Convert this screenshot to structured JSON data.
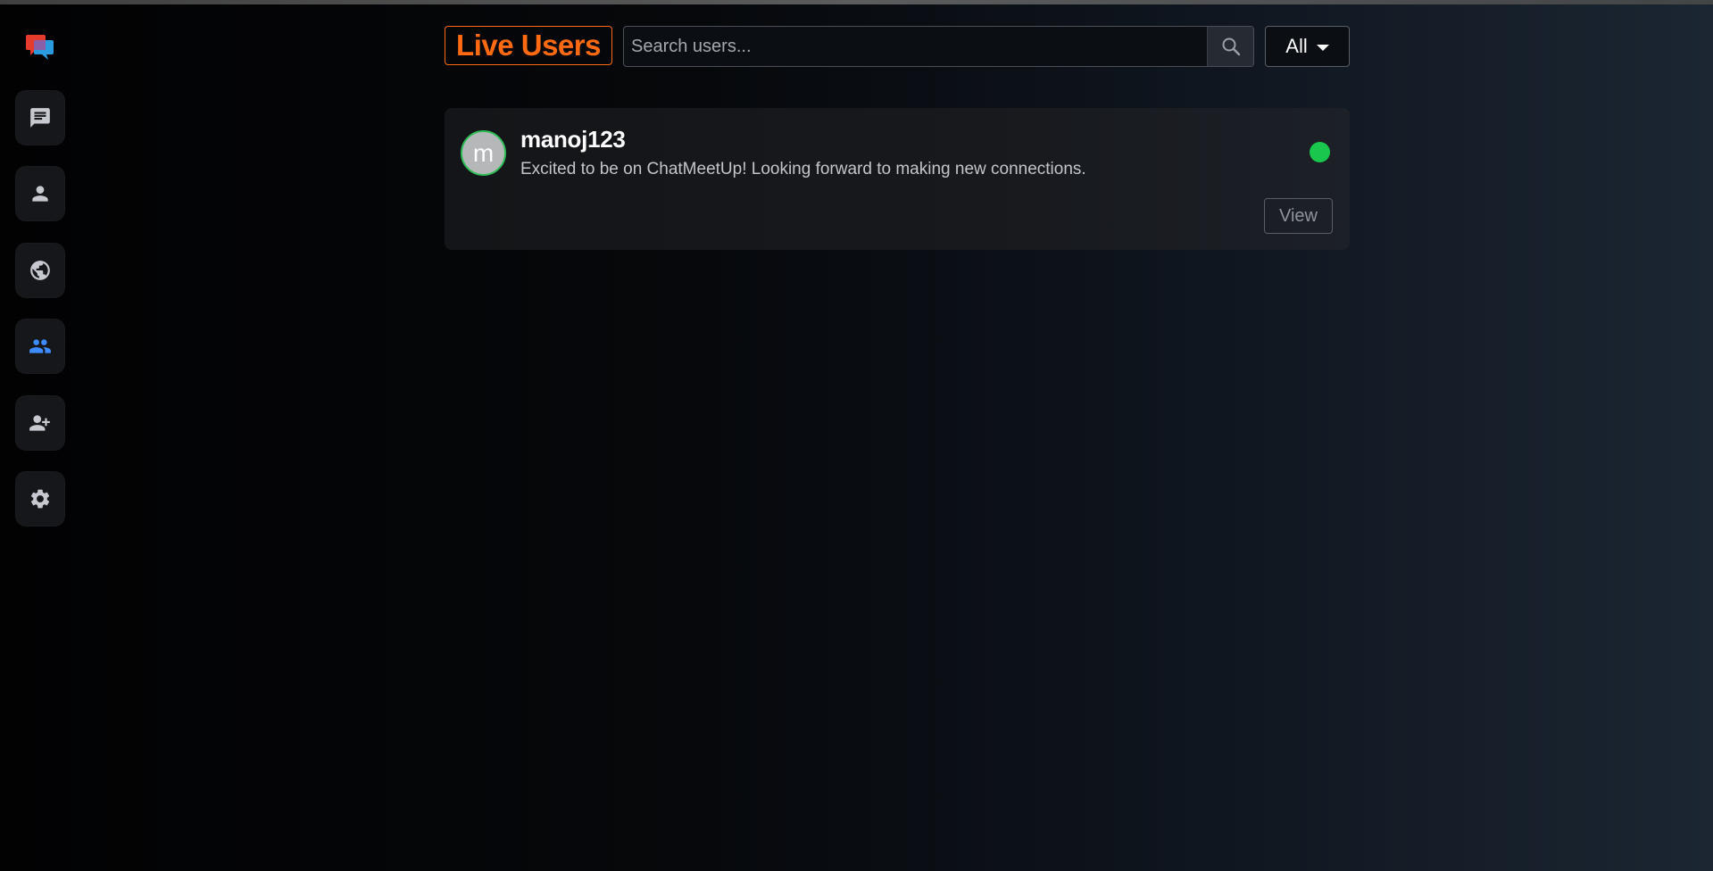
{
  "sidebar": {
    "logo": "chat-logo-icon",
    "items": [
      {
        "name": "chats",
        "icon": "message-icon",
        "active": false
      },
      {
        "name": "profile",
        "icon": "person-icon",
        "active": false
      },
      {
        "name": "global",
        "icon": "globe-icon",
        "active": false
      },
      {
        "name": "live-users",
        "icon": "people-icon",
        "active": true
      },
      {
        "name": "add-friend",
        "icon": "person-add-icon",
        "active": false
      },
      {
        "name": "settings",
        "icon": "gear-icon",
        "active": false
      }
    ]
  },
  "header": {
    "title": "Live Users",
    "search_placeholder": "Search users...",
    "search_value": "",
    "filter_selected": "All"
  },
  "users": [
    {
      "avatar_letter": "m",
      "username": "manoj123",
      "bio": "Excited to be on ChatMeetUp! Looking forward to making new connections.",
      "online": true,
      "action_label": "View"
    }
  ],
  "colors": {
    "accent": "#ff6a13",
    "active_icon": "#3d8bfd",
    "online": "#18c74b"
  }
}
